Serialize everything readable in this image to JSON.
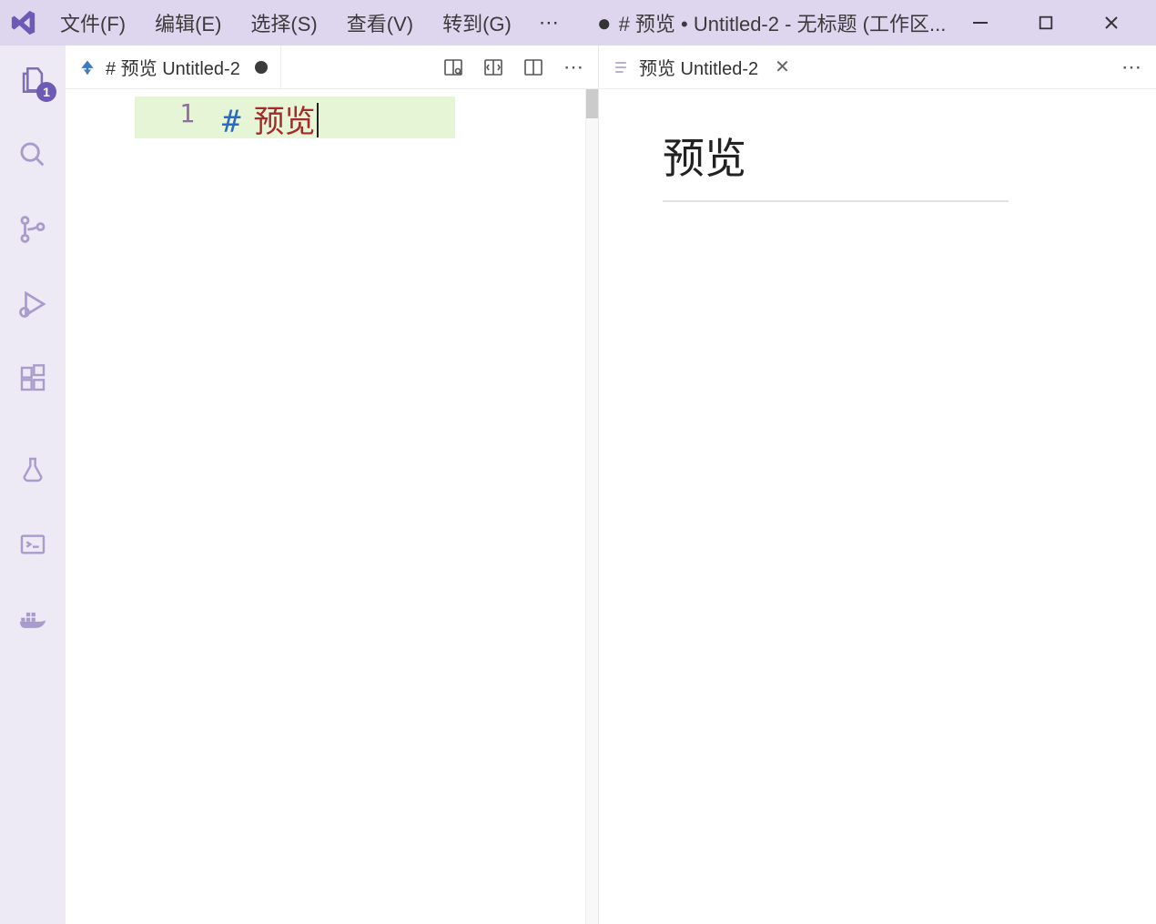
{
  "titlebar": {
    "menus": [
      "文件(F)",
      "编辑(E)",
      "选择(S)",
      "查看(V)",
      "转到(G)"
    ],
    "title": "# 预览 • Untitled-2 - 无标题 (工作区..."
  },
  "activity": {
    "explorer_badge": "1"
  },
  "left_pane": {
    "tab_label": "# 预览  Untitled-2",
    "line_number": "1",
    "code_hash": "#",
    "code_text": "预览"
  },
  "right_pane": {
    "tab_label": "预览 Untitled-2",
    "preview_heading": "预览"
  }
}
